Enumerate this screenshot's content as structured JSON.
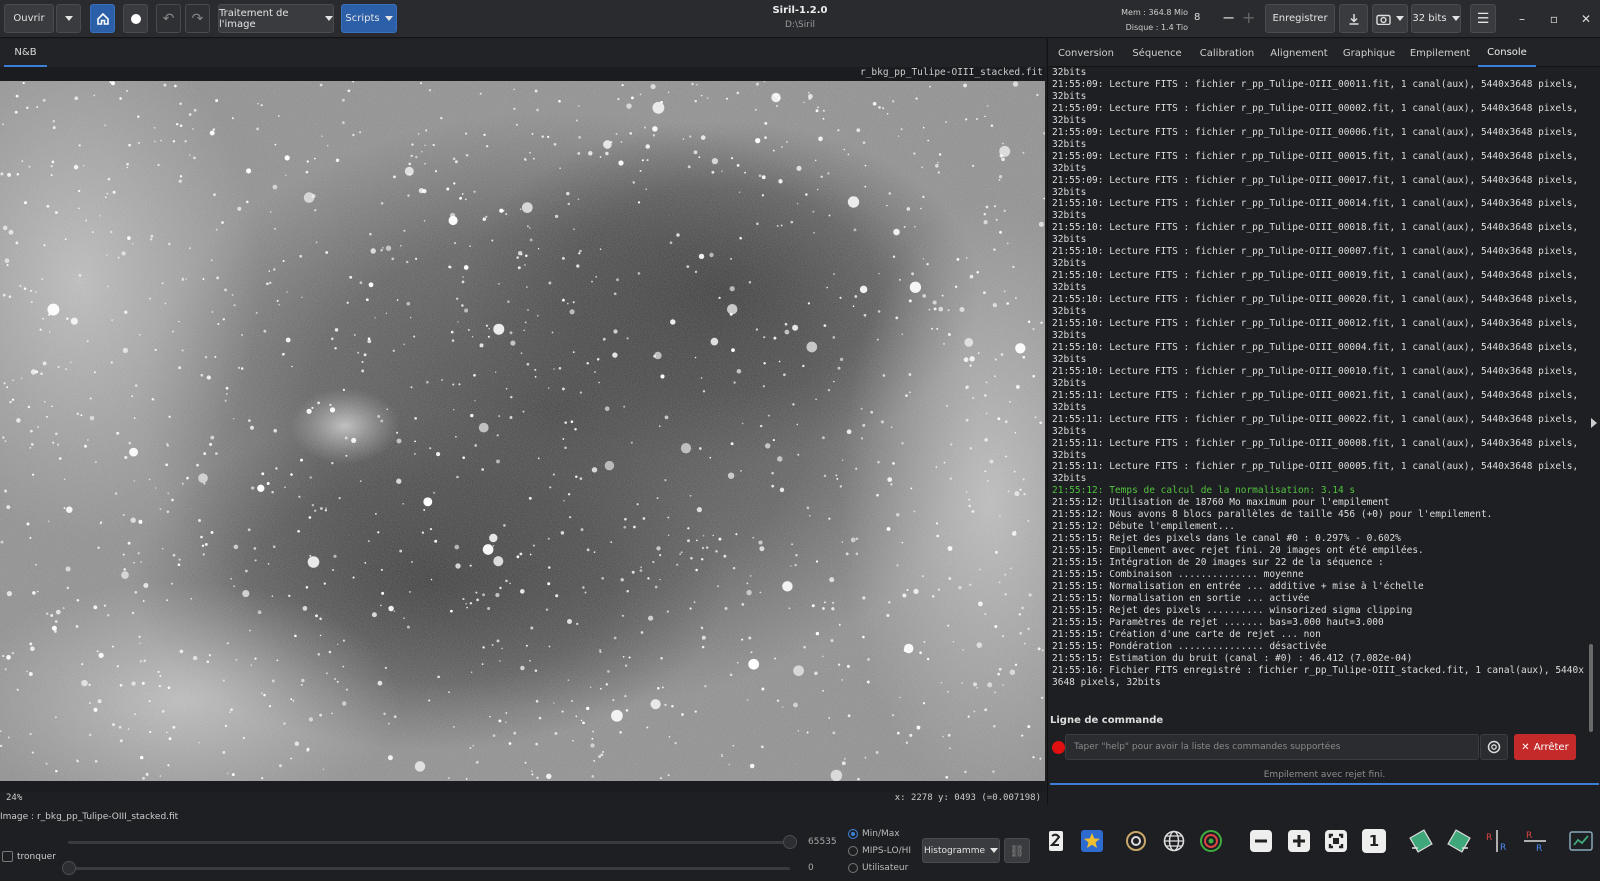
{
  "window": {
    "title": "Siril-1.2.0",
    "subtitle": "D:\\Siril",
    "mem": "Mem : 364.8 Mio",
    "disk": "Disque : 1.4 Tio",
    "cpu_value": "8",
    "bit_depth": "32 bits"
  },
  "toolbar": {
    "open": "Ouvrir",
    "image_processing": "Traitement de l'image",
    "scripts": "Scripts",
    "save": "Enregistrer"
  },
  "viewer": {
    "tab": "N&B",
    "filename": "r_bkg_pp_Tulipe-OIII_stacked.fit",
    "zoom": "24%",
    "coords": "x: 2278 y: 0493 (=0.007198)"
  },
  "right_tabs": [
    "Conversion",
    "Séquence",
    "Calibration",
    "Alignement",
    "Graphique",
    "Empilement",
    "Console"
  ],
  "console": {
    "lines": [
      {
        "t": "32bits",
        "c": ""
      },
      {
        "t": "21:55:09: Lecture FITS : fichier r_pp_Tulipe-OIII_00011.fit, 1 canal(aux), 5440x3648 pixels, 32bits",
        "c": ""
      },
      {
        "t": "21:55:09: Lecture FITS : fichier r_pp_Tulipe-OIII_00002.fit, 1 canal(aux), 5440x3648 pixels, 32bits",
        "c": ""
      },
      {
        "t": "21:55:09: Lecture FITS : fichier r_pp_Tulipe-OIII_00006.fit, 1 canal(aux), 5440x3648 pixels, 32bits",
        "c": ""
      },
      {
        "t": "21:55:09: Lecture FITS : fichier r_pp_Tulipe-OIII_00015.fit, 1 canal(aux), 5440x3648 pixels, 32bits",
        "c": ""
      },
      {
        "t": "21:55:09: Lecture FITS : fichier r_pp_Tulipe-OIII_00017.fit, 1 canal(aux), 5440x3648 pixels, 32bits",
        "c": ""
      },
      {
        "t": "21:55:10: Lecture FITS : fichier r_pp_Tulipe-OIII_00014.fit, 1 canal(aux), 5440x3648 pixels, 32bits",
        "c": ""
      },
      {
        "t": "21:55:10: Lecture FITS : fichier r_pp_Tulipe-OIII_00018.fit, 1 canal(aux), 5440x3648 pixels, 32bits",
        "c": ""
      },
      {
        "t": "21:55:10: Lecture FITS : fichier r_pp_Tulipe-OIII_00007.fit, 1 canal(aux), 5440x3648 pixels, 32bits",
        "c": ""
      },
      {
        "t": "21:55:10: Lecture FITS : fichier r_pp_Tulipe-OIII_00019.fit, 1 canal(aux), 5440x3648 pixels, 32bits",
        "c": ""
      },
      {
        "t": "21:55:10: Lecture FITS : fichier r_pp_Tulipe-OIII_00020.fit, 1 canal(aux), 5440x3648 pixels, 32bits",
        "c": ""
      },
      {
        "t": "21:55:10: Lecture FITS : fichier r_pp_Tulipe-OIII_00012.fit, 1 canal(aux), 5440x3648 pixels, 32bits",
        "c": ""
      },
      {
        "t": "21:55:10: Lecture FITS : fichier r_pp_Tulipe-OIII_00004.fit, 1 canal(aux), 5440x3648 pixels, 32bits",
        "c": ""
      },
      {
        "t": "21:55:10: Lecture FITS : fichier r_pp_Tulipe-OIII_00010.fit, 1 canal(aux), 5440x3648 pixels, 32bits",
        "c": ""
      },
      {
        "t": "21:55:11: Lecture FITS : fichier r_pp_Tulipe-OIII_00021.fit, 1 canal(aux), 5440x3648 pixels, 32bits",
        "c": ""
      },
      {
        "t": "21:55:11: Lecture FITS : fichier r_pp_Tulipe-OIII_00022.fit, 1 canal(aux), 5440x3648 pixels, 32bits",
        "c": ""
      },
      {
        "t": "21:55:11: Lecture FITS : fichier r_pp_Tulipe-OIII_00008.fit, 1 canal(aux), 5440x3648 pixels, 32bits",
        "c": ""
      },
      {
        "t": "21:55:11: Lecture FITS : fichier r_pp_Tulipe-OIII_00005.fit, 1 canal(aux), 5440x3648 pixels, 32bits",
        "c": ""
      },
      {
        "t": "21:55:12: Temps de calcul de la normalisation: 3.14 s",
        "c": "green"
      },
      {
        "t": "21:55:12: Utilisation de 18760 Mo maximum pour l'empilement",
        "c": ""
      },
      {
        "t": "21:55:12: Nous avons 8 blocs parallèles de taille 456 (+0) pour l'empilement.",
        "c": ""
      },
      {
        "t": "21:55:12: Débute l'empilement...",
        "c": ""
      },
      {
        "t": "21:55:15: Rejet des pixels dans le canal #0 : 0.297% - 0.602%",
        "c": ""
      },
      {
        "t": "21:55:15: Empilement avec rejet fini. 20 images ont été empilées.",
        "c": ""
      },
      {
        "t": "21:55:15: Intégration de 20 images sur 22 de la séquence :",
        "c": ""
      },
      {
        "t": "21:55:15: Combinaison .............. moyenne",
        "c": ""
      },
      {
        "t": "21:55:15: Normalisation en entrée ... additive + mise à l'échelle",
        "c": ""
      },
      {
        "t": "21:55:15: Normalisation en sortie ... activée",
        "c": ""
      },
      {
        "t": "21:55:15: Rejet des pixels .......... winsorized sigma clipping",
        "c": ""
      },
      {
        "t": "21:55:15: Paramètres de rejet ....... bas=3.000 haut=3.000",
        "c": ""
      },
      {
        "t": "21:55:15: Création d'une carte de rejet ... non",
        "c": ""
      },
      {
        "t": "21:55:15: Pondération ............... désactivée",
        "c": ""
      },
      {
        "t": "21:55:15: Estimation du bruit (canal : #0) : 46.412 (7.082e-04)",
        "c": ""
      },
      {
        "t": "21:55:16: Fichier FITS enregistré : fichier r_pp_Tulipe-OIII_stacked.fit, 1 canal(aux), 5440x3648 pixels, 32bits",
        "c": ""
      }
    ]
  },
  "command": {
    "label": "Ligne de commande",
    "placeholder": "Taper \"help\" pour avoir la liste des commandes supportées",
    "stop": "Arrêter",
    "status": "Empilement avec rejet fini."
  },
  "bottom": {
    "image_label": "Image : r_bkg_pp_Tulipe-OIII_stacked.fit",
    "truncate": "tronquer",
    "hi_value": "65535",
    "lo_value": "0",
    "modes": [
      "Min/Max",
      "MIPS-LO/HI",
      "Utilisateur"
    ],
    "display_mode": "Histogramme",
    "one_label": "1"
  },
  "colors": {
    "accent": "#3c7fd6",
    "stop": "#c42a2a",
    "green_log": "#52c33f"
  }
}
